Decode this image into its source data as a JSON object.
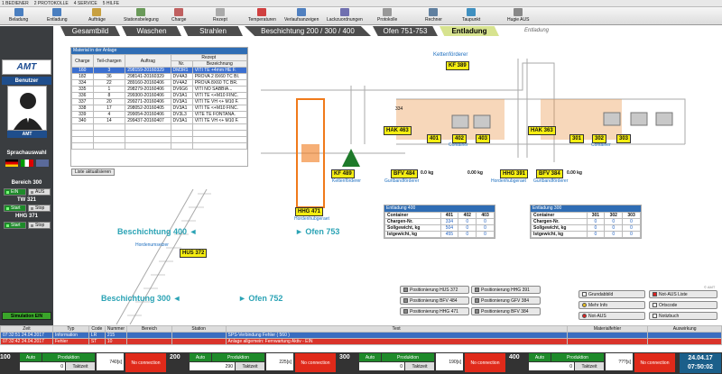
{
  "menubar": {
    "items": [
      "1 BEDIENER",
      "2 PROTOKOLLE",
      "4 SERVICE",
      "5 HILFE"
    ]
  },
  "toolbar": {
    "buttons": [
      "Beladung",
      "Entladung",
      "Aufträge",
      "Stationsbelegung",
      "Charge",
      "Rezept",
      "Temperaturen",
      "Verlaufsanzeigen",
      "Lackzuordnungen",
      "Protokolle",
      "Rechner",
      "Taupunkt",
      "Hugie AUS"
    ]
  },
  "brand": {
    "logo": "AMT",
    "user_label": "Benutzer",
    "user_name": "AMT",
    "language_label": "Sprachauswahl"
  },
  "bereich": [
    {
      "title": "Bereich 300",
      "btn1": "EIN",
      "btn2": "AUS"
    },
    {
      "title": "TW 321",
      "btn1": "Start",
      "btn2": "Stop"
    },
    {
      "title": "HHG 371",
      "btn1": "Start",
      "btn2": "Stop"
    }
  ],
  "simulation": "Simulation EIN",
  "tabs": [
    "Gesamtbild",
    "Waschen",
    "Strahlen",
    "Beschichtung   200 / 300 / 400",
    "Ofen 751-753",
    "Entladung"
  ],
  "page_subtitle": "Entladung",
  "material": {
    "title": "Material in der Anlage",
    "headers": [
      "Charge",
      "Teil-chargen",
      "Auftrag",
      "Nr.",
      "Bezeichnung"
    ],
    "rezept_header": "Rezept",
    "rows": [
      [
        "160",
        "3",
        "298159-20160329",
        "DM3R1",
        "VITI TE +4mm HE F."
      ],
      [
        "182",
        "36",
        "298141-20160329",
        "DV4A3",
        "PROVA 2 8X60 TC BI."
      ],
      [
        "334",
        "22",
        "289160-20160406",
        "DV4A2",
        "PROVA 8X60 TC BR."
      ],
      [
        "335",
        "1",
        "298279-20160406",
        "DV6G6",
        "VITI NO SABBIA..."
      ],
      [
        "336",
        "8",
        "299300-20160406",
        "DV3A1",
        "VITI TE <+M10 FINC."
      ],
      [
        "337",
        "20",
        "299271-20160406",
        "DV3A1",
        "VITI TE VH <+ M10 F."
      ],
      [
        "338",
        "17",
        "298052-20160405",
        "DV3A1",
        "VITI TE <+M10 FINC."
      ],
      [
        "339",
        "4",
        "299054-20160406",
        "DV3L3",
        "VITE TE FONTANA."
      ],
      [
        "340",
        "14",
        "299437-20160407",
        "DV3A1",
        "VITI TE VH <+ M10 F."
      ]
    ],
    "update_btn": "Liste aktualisieren"
  },
  "plant": {
    "kf389": "KF 389",
    "kettenfoerderer_top": "Kettenförderer",
    "hak463": "HAK 463",
    "hak363": "HAK 363",
    "hhg471": "HHG 471",
    "hordenhubgeraet": "Hordenhubgeraet",
    "kf489": "KF 489",
    "bfv484": "BFV 484",
    "hhg391": "HHG 391",
    "bfv384": "BFV 384",
    "kettenfoerderer": "Kettenförderer",
    "gurtbandfoerderer": "Gurtbandförderer",
    "hordenhubgeraet2": "Hordenhubgeraet",
    "kg0": "0.0",
    "kg_unit": "kg",
    "kg1": "0.00",
    "kg2": "0.00",
    "c401": "401",
    "c402": "402",
    "c403": "403",
    "c301": "301",
    "c302": "302",
    "c303": "303",
    "container": "Container",
    "w334": "334",
    "hus372": "HUS 372",
    "hordenumsetzer": "Hordenumsetzer",
    "besch400": "Beschichtung 400",
    "ofen753": "Ofen 753",
    "besch300": "Beschichtung 300",
    "ofen752": "Ofen 752",
    "amt_small": "© AMT"
  },
  "ent400": {
    "title": "Entladung 400",
    "cols": [
      "Container",
      "401",
      "402",
      "403"
    ],
    "rows": [
      [
        "Chargen-Nr.",
        "334",
        "0",
        "0"
      ],
      [
        "Sollgewicht, kg",
        "504",
        "0",
        "0"
      ],
      [
        "Istgewicht, kg",
        "455",
        "0",
        "0"
      ]
    ]
  },
  "ent300": {
    "title": "Entladung 300",
    "cols": [
      "Container",
      "301",
      "302",
      "303"
    ],
    "rows": [
      [
        "Chargen-Nr.",
        "0",
        "0",
        "0"
      ],
      [
        "Sollgewicht, kg",
        "0",
        "0",
        "0"
      ],
      [
        "Istgewicht, kg",
        "0",
        "0",
        "0"
      ]
    ]
  },
  "pos_buttons": [
    "Positionierung HUS 372",
    "Positionierung HHG 391",
    "Positionierung BFV 484",
    "Positionierung GFV 384",
    "Positionierung HHG 471",
    "Positionierung BFV 384"
  ],
  "nav_buttons": [
    "Grundabbild",
    "Not-AUS Liste",
    "Mehr Info",
    "Ortscode",
    "Not-AUS",
    "Notizbuch"
  ],
  "status": {
    "headers": [
      "Zeit",
      "Typ",
      "Code",
      "Nummer",
      "Bereich",
      "Station",
      "Text",
      "Materialfehler",
      "Auswirkung"
    ],
    "rows": [
      [
        "07:32:51 24.04.2017",
        "Information",
        "LR",
        "215",
        "",
        "",
        "SPS-Verbindung Fehler  ( 560 )",
        "",
        ""
      ],
      [
        "07:32:42 24.04.2017",
        "Fehler",
        "ST",
        "10",
        "",
        "",
        "Anlage allgemein: Fernwartung Aktiv - EIN",
        "",
        ""
      ]
    ]
  },
  "bottom": [
    {
      "num": "100",
      "mode": "Auto",
      "prod": "Produktion",
      "v1": "0",
      "tt": "Taktzeit",
      "tv": "740[s]",
      "nc": "No connection"
    },
    {
      "num": "200",
      "mode": "Auto",
      "prod": "Produktion",
      "v1": "290",
      "tt": "Taktzeit",
      "tv": "225[s]",
      "nc": "No connection"
    },
    {
      "num": "300",
      "mode": "Auto",
      "prod": "Produktion",
      "v1": "0",
      "tt": "Taktzeit",
      "tv": "190[s]",
      "nc": "No connection"
    },
    {
      "num": "400",
      "mode": "Auto",
      "prod": "Produktion",
      "v1": "0",
      "tt": "Taktzeit",
      "tv": "???[s]",
      "nc": "No connection"
    }
  ],
  "datetime": {
    "date": "24.04.17",
    "time": "07:50:02"
  }
}
